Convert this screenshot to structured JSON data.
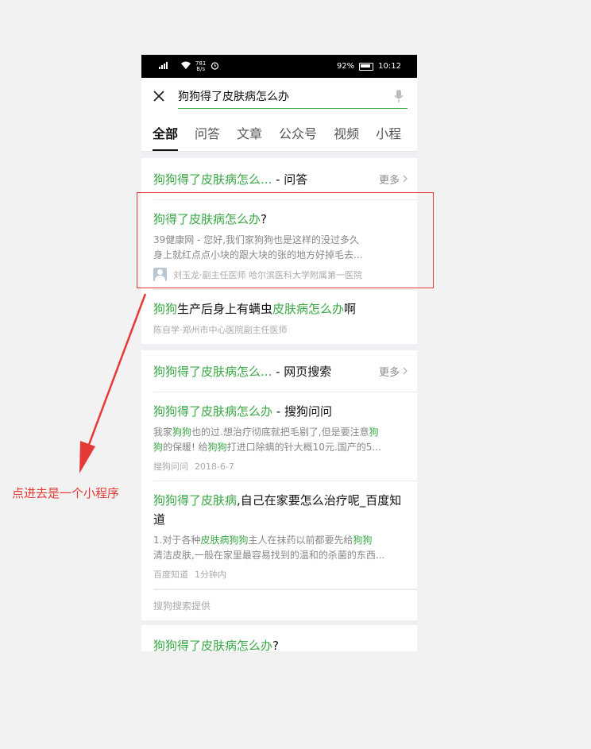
{
  "status_bar": {
    "signal": "⁴ᴳ",
    "speed": "781",
    "speed_unit": "B/s",
    "battery": "92%",
    "time": "10:12"
  },
  "search": {
    "query": "狗狗得了皮肤病怎么办"
  },
  "tabs": [
    "全部",
    "问答",
    "文章",
    "公众号",
    "视频",
    "小程"
  ],
  "qa_card": {
    "title_highlight": "狗狗得了皮肤病怎么...",
    "title_suffix": " - 问答",
    "more": "更多",
    "item1": {
      "title_highlight": "狗得了皮肤病怎么办",
      "title_rest": "?",
      "snippet_line1": "39健康网 - 您好,我们家狗狗也是这样的没过多久",
      "snippet_line2": "身上就红点点小块的跟大块的张的地方好掉毛去...",
      "author": "刘玉龙·副主任医师 哈尔滨医科大学附属第一医院"
    },
    "item2": {
      "t1": "狗狗",
      "t2": "生产后身上有螨虫",
      "t3": "皮肤病怎么办",
      "t4": "啊",
      "author": "陈自学·郑州市中心医院副主任医师"
    }
  },
  "web_card": {
    "title_highlight": "狗狗得了皮肤病怎么...",
    "title_suffix": " - 网页搜索",
    "more": "更多",
    "item1": {
      "title_highlight": "狗狗得了皮肤病怎么办",
      "title_rest": " - 搜狗问问",
      "s1": "我家",
      "s2": "狗狗",
      "s3": "也的过.想治疗彻底就把毛剔了,但是要注意",
      "s4": "狗",
      "s5": "狗",
      "s6": "的保暖! 给",
      "s7": "狗狗",
      "s8": "打进口除螨的针大概10元.国产的5...",
      "source": "搜狗问问",
      "date": "2018-6-7"
    },
    "item2": {
      "title_highlight": "狗狗得了皮肤病",
      "title_rest": ",自己在家要怎么治疗呢_百度知道",
      "s1": "1.对于各种",
      "s2": "皮肤病狗狗",
      "s3": "主人在抹药以前都要先给",
      "s4": "狗狗",
      "s5": "清洁皮肤,一般在家里最容易找到的温和的杀菌的东西...",
      "source": "百度知道",
      "date": "1分钟内"
    },
    "provider": "搜狗搜索提供"
  },
  "last_card": {
    "title_highlight": "狗狗得了皮肤病怎么办",
    "title_rest": "?"
  },
  "annotation": "点进去是一个小程序",
  "colors": {
    "highlight": "#3aa845",
    "annotation": "#e53935",
    "search_underline": "#3cb034"
  }
}
